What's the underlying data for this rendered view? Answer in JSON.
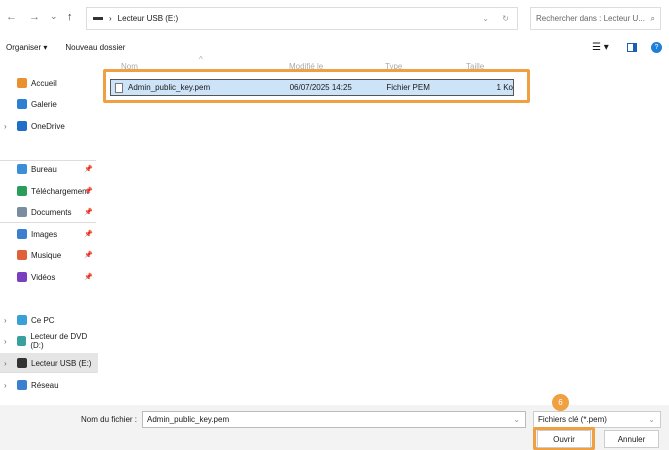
{
  "nav": {
    "back": "←",
    "forward": "→",
    "recent": "⌄",
    "up": "↑"
  },
  "address": {
    "separator": "›",
    "location": "Lecteur USB (E:)"
  },
  "search": {
    "placeholder": "Rechercher dans : Lecteur U..."
  },
  "toolbar": {
    "organize": "Organiser ▾",
    "new_folder": "Nouveau dossier"
  },
  "sidebar": [
    {
      "label": "Accueil",
      "color": "#e8912e"
    },
    {
      "label": "Galerie",
      "color": "#2d7fd3"
    },
    {
      "label": "OneDrive",
      "color": "#1f6fc8"
    },
    {
      "label": "Bureau",
      "color": "#3a8fd8"
    },
    {
      "label": "Téléchargement",
      "color": "#2a9d5a"
    },
    {
      "label": "Documents",
      "color": "#7a8ca0"
    },
    {
      "label": "Images",
      "color": "#3a7fd0"
    },
    {
      "label": "Musique",
      "color": "#e0603a"
    },
    {
      "label": "Vidéos",
      "color": "#7a3fc0"
    },
    {
      "label": "Ce PC",
      "color": "#3aa0d8"
    },
    {
      "label": "Lecteur de DVD (D:)",
      "color": "#3a9f9f"
    },
    {
      "label": "Lecteur USB (E:)",
      "color": "#333333"
    },
    {
      "label": "Réseau",
      "color": "#3a7fd0"
    }
  ],
  "columns": [
    "Nom",
    "Modifié le",
    "Type",
    "Taille"
  ],
  "files": [
    {
      "name": "Admin_public_key.pem",
      "modified": "06/07/2025 14:25",
      "type": "Fichier PEM",
      "size": "1 Ko"
    }
  ],
  "footer": {
    "filename_label": "Nom du fichier :",
    "filename_value": "Admin_public_key.pem",
    "filter": "Fichiers clé (*.pem)",
    "open": "Ouvrir",
    "cancel": "Annuler",
    "step_badge": "6"
  },
  "colors": {
    "highlight": "#f0a040",
    "selection": "#cde3f7"
  }
}
